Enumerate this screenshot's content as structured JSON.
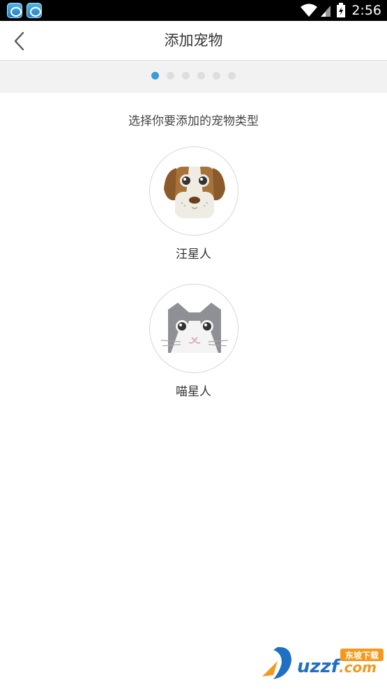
{
  "status_bar": {
    "time": "2:56",
    "icons": [
      "app-notification-icon",
      "app-notification-icon",
      "wifi-icon",
      "signal-icon",
      "battery-icon"
    ]
  },
  "header": {
    "title": "添加宠物",
    "back_icon": "chevron-left-icon"
  },
  "progress": {
    "total_steps": 6,
    "current_step": 1,
    "active_color": "#3a9bdc",
    "inactive_color": "#dedede"
  },
  "main": {
    "prompt": "选择你要添加的宠物类型",
    "pets": [
      {
        "label": "汪星人",
        "icon": "dog-face-icon"
      },
      {
        "label": "喵星人",
        "icon": "cat-face-icon"
      }
    ]
  },
  "watermark": {
    "text": "uzzf.com",
    "badge": "东坡下载"
  }
}
